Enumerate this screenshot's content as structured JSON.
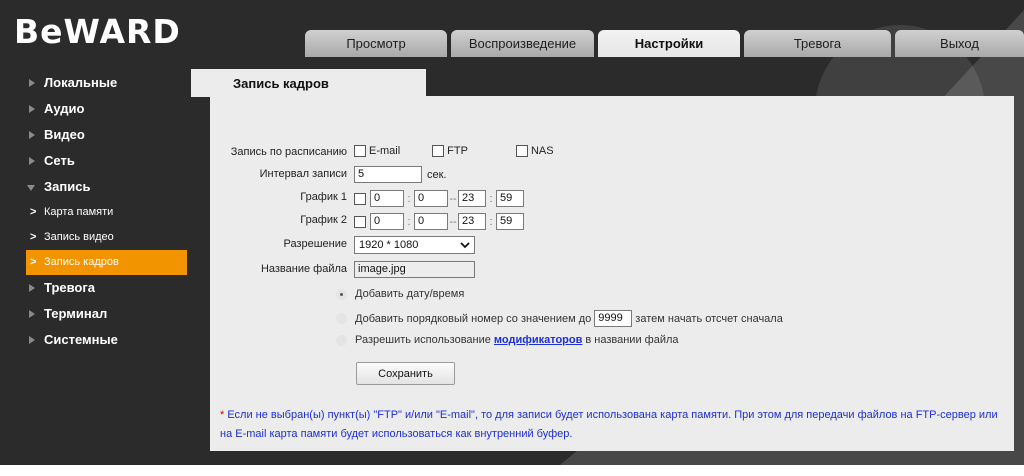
{
  "header": {
    "logo": "BeWARD",
    "tabs": [
      {
        "label": "Просмотр",
        "active": false
      },
      {
        "label": "Воспроизведение",
        "active": false
      },
      {
        "label": "Настройки",
        "active": true
      },
      {
        "label": "Тревога",
        "active": false
      },
      {
        "label": "Выход",
        "active": false
      }
    ]
  },
  "sidebar": {
    "items": [
      {
        "label": "Локальные"
      },
      {
        "label": "Аудио"
      },
      {
        "label": "Видео"
      },
      {
        "label": "Сеть"
      },
      {
        "label": "Запись",
        "expanded": true,
        "children": [
          {
            "label": "Карта памяти"
          },
          {
            "label": "Запись видео"
          },
          {
            "label": "Запись кадров",
            "active": true
          }
        ]
      },
      {
        "label": "Тревога"
      },
      {
        "label": "Терминал"
      },
      {
        "label": "Системные"
      }
    ],
    "active_color": "#f29400"
  },
  "page": {
    "title": "Запись кадров",
    "schedule": {
      "label": "Запись по расписанию",
      "options": [
        "E-mail",
        "FTP",
        "NAS"
      ]
    },
    "interval": {
      "label": "Интервал записи",
      "value": "5",
      "unit": "сек."
    },
    "schedule1": {
      "label": "График 1",
      "h1": "0",
      "m1": "0",
      "h2": "23",
      "m2": "59"
    },
    "schedule2": {
      "label": "График 2",
      "h1": "0",
      "m1": "0",
      "h2": "23",
      "m2": "59"
    },
    "resolution": {
      "label": "Разрешение",
      "value": "1920 * 1080"
    },
    "filename": {
      "label": "Название файла",
      "value": "image.jpg"
    },
    "naming": {
      "option1": "Добавить дату/время",
      "option2_prefix": "Добавить порядковый номер со значением до",
      "option2_value": "9999",
      "option2_suffix": "затем начать отсчет сначала",
      "option3_prefix": "Разрешить использование",
      "option3_link": "модификаторов",
      "option3_suffix": "в названии файла",
      "selected": 1
    },
    "save_label": "Сохранить",
    "note_star": "*",
    "note": "Если не выбран(ы) пункт(ы) \"FTP\" и/или \"E-mail\", то для записи будет использована карта памяти. При этом для передачи файлов на FTP-сервер или на E-mail карта памяти будет использоваться как внутренний буфер."
  },
  "icons": {
    "nav_arrow": "triangle-right-icon",
    "nav_expanded": "triangle-down-icon",
    "sub_arrow": "chevron-right-icon",
    "select_arrow": "chevron-down-icon",
    "background": "#2b2b2b",
    "panel": "#ececec",
    "link_color": "#1c2fd6",
    "note_star_color": "#e00000"
  }
}
